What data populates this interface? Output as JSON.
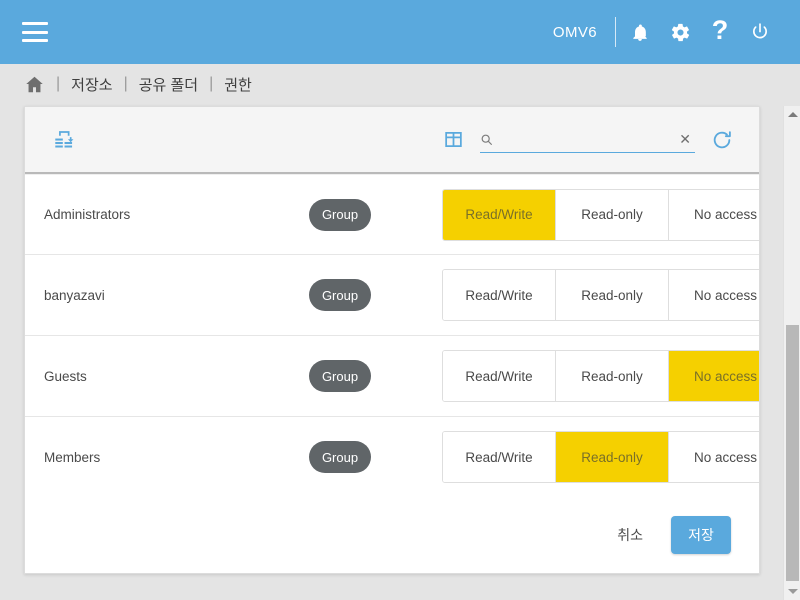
{
  "topbar": {
    "menu_icon": "hamburger-menu-icon",
    "hostname": "OMV6",
    "icons": [
      {
        "name": "notifications-bell-icon"
      },
      {
        "name": "settings-gear-icon"
      },
      {
        "name": "help-question-icon",
        "glyph": "?"
      },
      {
        "name": "power-icon"
      }
    ]
  },
  "breadcrumb": {
    "home_icon": "home-icon",
    "separator": "|",
    "items": [
      {
        "label": "저장소"
      },
      {
        "label": "공유 폴더"
      },
      {
        "label": "권한"
      }
    ]
  },
  "toolbar": {
    "reset_icon": "apply-changes-icon",
    "columns_icon": "grid-columns-icon",
    "search_icon": "search-icon",
    "search_value": "",
    "search_placeholder": "",
    "clear_icon": "clear-x-icon",
    "clear_glyph": "✕",
    "reload_icon": "reload-refresh-icon"
  },
  "table": {
    "permission_options": [
      "Read/Write",
      "Read-only",
      "No access"
    ],
    "rows": [
      {
        "name": "Administrators",
        "type": "Group",
        "selected": 0
      },
      {
        "name": "banyazavi",
        "type": "Group",
        "selected": -1
      },
      {
        "name": "Guests",
        "type": "Group",
        "selected": 2
      },
      {
        "name": "Members",
        "type": "Group",
        "selected": 1
      }
    ]
  },
  "footer": {
    "cancel_label": "취소",
    "save_label": "저장"
  },
  "scrollbar": {
    "up_icon": "scroll-up-arrow-icon",
    "down_icon": "scroll-down-arrow-icon"
  },
  "colors": {
    "header_blue": "#5aa9dd",
    "highlight_yellow": "#f5d000",
    "chip_gray": "#606568",
    "page_bg": "#e4e4e4"
  }
}
